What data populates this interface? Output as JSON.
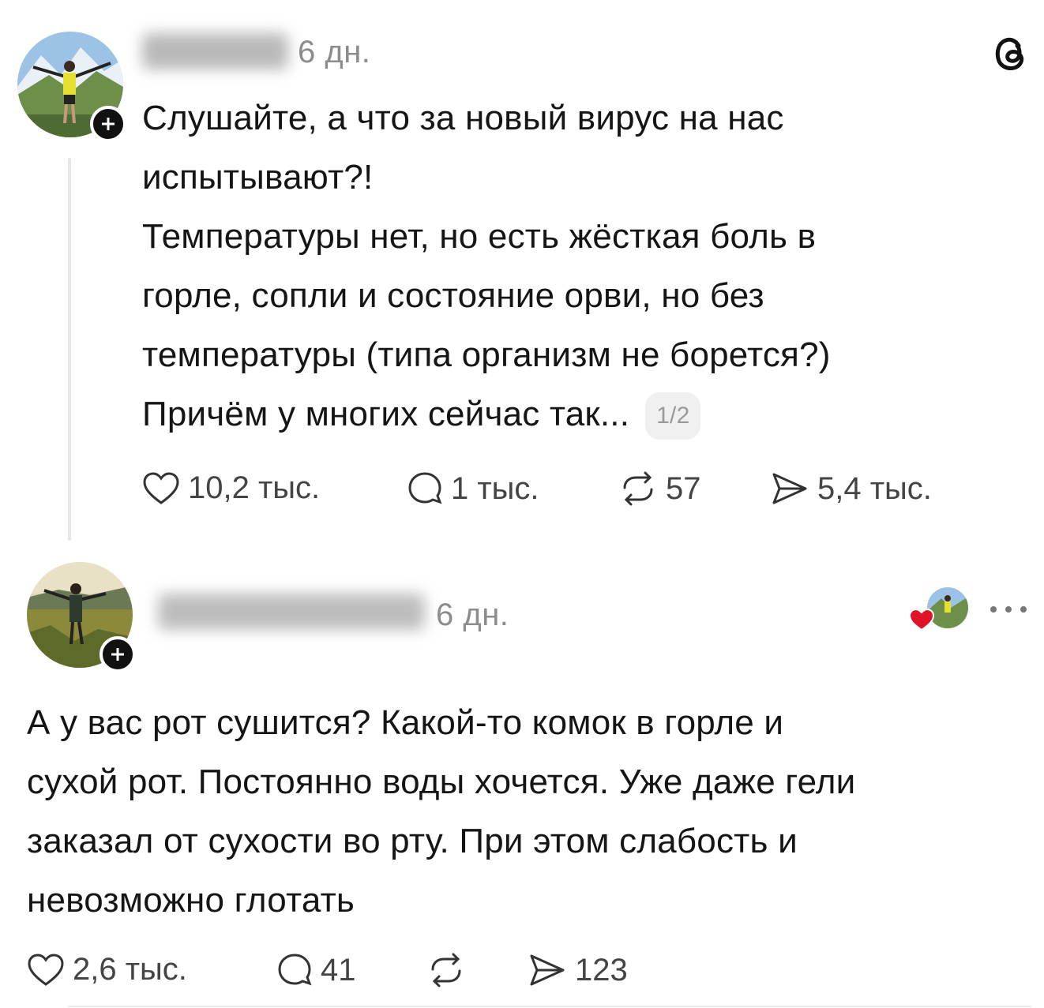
{
  "post1": {
    "avatar": "avatar-mountain-yellow-shirt",
    "time": "6 дн.",
    "text_line1": "Слушайте, а что за новый вирус на нас",
    "text_line2": "испытывают?!",
    "text_line3": "Температуры нет, но есть жёсткая боль в",
    "text_line4": "горле, сопли и состояние орви, но без",
    "text_line5": "температуры (типа организм не борется?)",
    "text_line6": "Причём у многих сейчас так...",
    "pager": "1/2",
    "stats": {
      "likes": "10,2 тыс.",
      "comments": "1 тыс.",
      "reposts": "57",
      "shares": "5,4 тыс."
    }
  },
  "post2": {
    "avatar": "avatar-field-sunset",
    "time": "6 дн.",
    "text_line1": "А у вас рот сушится? Какой-то комок в горле и",
    "text_line2": "сухой рот. Постоянно воды хочется. Уже даже гели",
    "text_line3": "заказал от сухости во рту. При этом слабость и",
    "text_line4": "невозможно глотать",
    "stats": {
      "likes": "2,6 тыс.",
      "comments": "41",
      "shares": "123"
    }
  },
  "icons": [
    "threads-logo-icon",
    "heart-icon",
    "comment-icon",
    "repost-icon",
    "share-icon",
    "more-icon",
    "plus-icon"
  ],
  "colors": {
    "text": "#151515",
    "muted": "#8c8c8c",
    "heart_red": "#e0132b",
    "badge": "#111111"
  }
}
